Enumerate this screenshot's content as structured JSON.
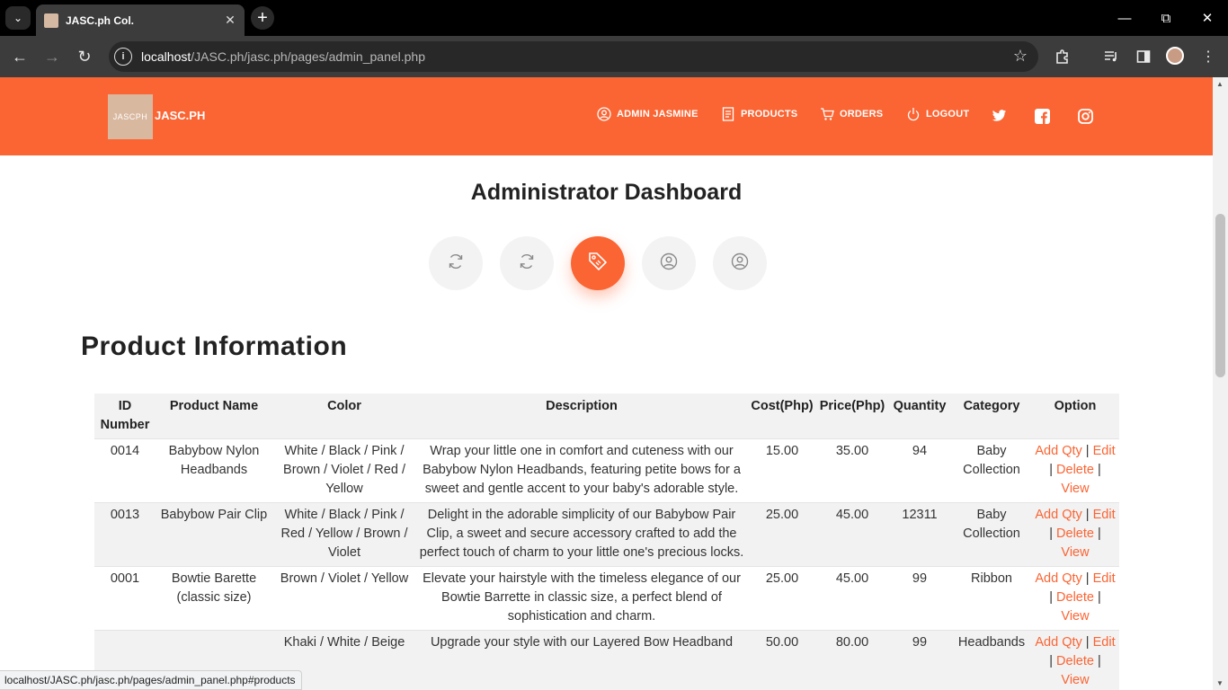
{
  "browser": {
    "tab_title": "JASC.ph Col.",
    "url_host": "localhost",
    "url_path": "/JASC.ph/jasc.ph/pages/admin_panel.php",
    "status_url": "localhost/JASC.ph/jasc.ph/pages/admin_panel.php#products"
  },
  "header": {
    "logo_mark": "JASCPH",
    "logo_text": "JASC.PH",
    "nav": [
      {
        "label": "ADMIN JASMINE",
        "icon": "user-circle-icon"
      },
      {
        "label": "PRODUCTS",
        "icon": "document-icon"
      },
      {
        "label": "ORDERS",
        "icon": "cart-icon"
      },
      {
        "label": "LOGOUT",
        "icon": "logout-icon"
      }
    ],
    "social": [
      "twitter-icon",
      "facebook-icon",
      "instagram-icon"
    ]
  },
  "dashboard": {
    "title": "Administrator Dashboard",
    "buttons": [
      {
        "icon": "refresh-icon",
        "active": false
      },
      {
        "icon": "refresh-icon",
        "active": false
      },
      {
        "icon": "tag-icon",
        "active": true
      },
      {
        "icon": "user-circle-icon",
        "active": false
      },
      {
        "icon": "user-circle-icon",
        "active": false
      }
    ]
  },
  "products": {
    "section_title": "Product Information",
    "columns": [
      "ID Number",
      "Product Name",
      "Color",
      "Description",
      "Cost(Php)",
      "Price(Php)",
      "Quantity",
      "Category",
      "Option"
    ],
    "option_links": [
      "Add Qty",
      "Edit",
      "Delete",
      "View"
    ],
    "rows": [
      {
        "id": "0014",
        "name": "Babybow Nylon Headbands",
        "color": "White / Black / Pink / Brown / Violet / Red / Yellow",
        "description": "Wrap your little one in comfort and cuteness with our Babybow Nylon Headbands, featuring petite bows for a sweet and gentle accent to your baby's adorable style.",
        "cost": "15.00",
        "price": "35.00",
        "quantity": "94",
        "category": "Baby Collection"
      },
      {
        "id": "0013",
        "name": "Babybow Pair Clip",
        "color": "White / Black / Pink / Red / Yellow / Brown / Violet",
        "description": "Delight in the adorable simplicity of our Babybow Pair Clip, a sweet and secure accessory crafted to add the perfect touch of charm to your little one's precious locks.",
        "cost": "25.00",
        "price": "45.00",
        "quantity": "12311",
        "category": "Baby Collection"
      },
      {
        "id": "0001",
        "name": "Bowtie Barette (classic size)",
        "color": "Brown / Violet / Yellow",
        "description": "Elevate your hairstyle with the timeless elegance of our Bowtie Barrette in classic size, a perfect blend of sophistication and charm.",
        "cost": "25.00",
        "price": "45.00",
        "quantity": "99",
        "category": "Ribbon"
      },
      {
        "id": "",
        "name": "",
        "color": "Khaki / White / Beige",
        "description": "Upgrade your style with our Layered Bow Headband",
        "cost": "50.00",
        "price": "80.00",
        "quantity": "99",
        "category": "Headbands"
      }
    ]
  }
}
